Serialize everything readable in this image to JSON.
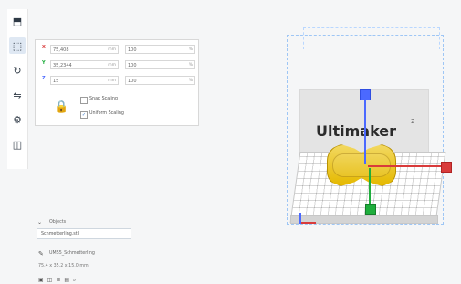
{
  "toolbar": {
    "tools": [
      {
        "name": "move-tool",
        "icon": "move-icon",
        "active": false
      },
      {
        "name": "scale-tool",
        "icon": "scale-icon",
        "active": true
      },
      {
        "name": "rotate-tool",
        "icon": "rotate-icon",
        "active": false
      },
      {
        "name": "mirror-tool",
        "icon": "mirror-icon",
        "active": false
      },
      {
        "name": "per-model-settings-tool",
        "icon": "settings-icon",
        "active": false
      },
      {
        "name": "support-blocker-tool",
        "icon": "support-icon",
        "active": false
      }
    ]
  },
  "panel": {
    "rows": [
      {
        "axis": "X",
        "value": "75,408",
        "unit": "mm",
        "percent": "100",
        "percent_unit": "%"
      },
      {
        "axis": "Y",
        "value": "35,2344",
        "unit": "mm",
        "percent": "100",
        "percent_unit": "%"
      },
      {
        "axis": "Z",
        "value": "15",
        "unit": "mm",
        "percent": "100",
        "percent_unit": "%"
      }
    ],
    "checkboxes": [
      {
        "label": "Snap Scaling",
        "checked": false
      },
      {
        "label": "Uniform Scaling",
        "checked": true
      }
    ]
  },
  "objects": {
    "title": "Objects",
    "selected": "Schmetterling.stl",
    "filename": "UMS5_Schmetterling",
    "dimensions": "75.4 x 35.2 x 15.0 mm",
    "bottom_icons": [
      "cube-icon",
      "view-icon",
      "layers-icon",
      "front-icon",
      "search-icon"
    ]
  },
  "viewport": {
    "brand": "Ultimaker",
    "brand_suffix": "2",
    "wire_color": "#9ec6f5",
    "model_color": "#e5b900",
    "axis_colors": {
      "x": "#d93b3b",
      "y": "#1fae3d",
      "z": "#4b69ff"
    }
  }
}
